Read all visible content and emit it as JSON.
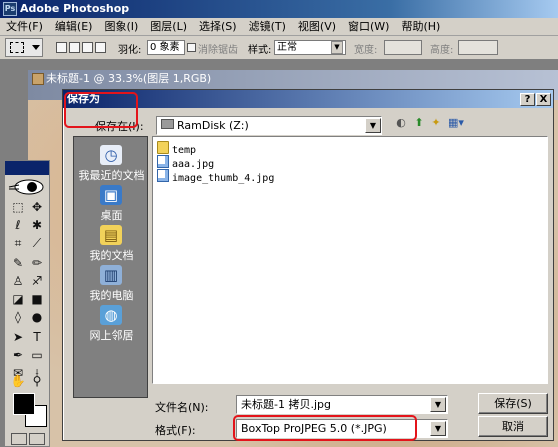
{
  "app": {
    "title": "Adobe Photoshop",
    "logo_text": "Ps",
    "menu": [
      "文件(F)",
      "编辑(E)",
      "图象(I)",
      "图层(L)",
      "选择(S)",
      "滤镜(T)",
      "视图(V)",
      "窗口(W)",
      "帮助(H)"
    ]
  },
  "options_bar": {
    "feather_label": "羽化:",
    "feather_value": "0 象素",
    "antialias_label": "消除锯齿",
    "style_label": "样式:",
    "style_value": "正常",
    "width_label": "宽度:",
    "height_label": "高度:"
  },
  "document": {
    "title": "未标题-1 @ 33.3%(图层 1,RGB)"
  },
  "dialog": {
    "title": "保存为",
    "help_btn": "?",
    "close_btn": "X",
    "save_in_label": "保存在(I):",
    "save_in_value": "RamDisk (Z:)",
    "places": [
      {
        "label": "我最近的文档",
        "icon": "recent-docs-icon"
      },
      {
        "label": "桌面",
        "icon": "desktop-icon"
      },
      {
        "label": "我的文档",
        "icon": "my-documents-icon"
      },
      {
        "label": "我的电脑",
        "icon": "my-computer-icon"
      },
      {
        "label": "网上邻居",
        "icon": "network-places-icon"
      }
    ],
    "files": [
      {
        "name": "temp",
        "type": "folder"
      },
      {
        "name": "aaa.jpg",
        "type": "jpg"
      },
      {
        "name": "image_thumb_4.jpg",
        "type": "jpg"
      }
    ],
    "filename_label": "文件名(N):",
    "filename_value": "未标题-1 拷贝.jpg",
    "format_label": "格式(F):",
    "format_value": "BoxTop ProJPEG 5.0 (*.JPG)",
    "save_btn": "保存(S)",
    "cancel_btn": "取消"
  },
  "colors": {
    "highlight": "#e3141b",
    "title_bar": "#0a246a",
    "dialog_bg": "#d4d0c8"
  }
}
